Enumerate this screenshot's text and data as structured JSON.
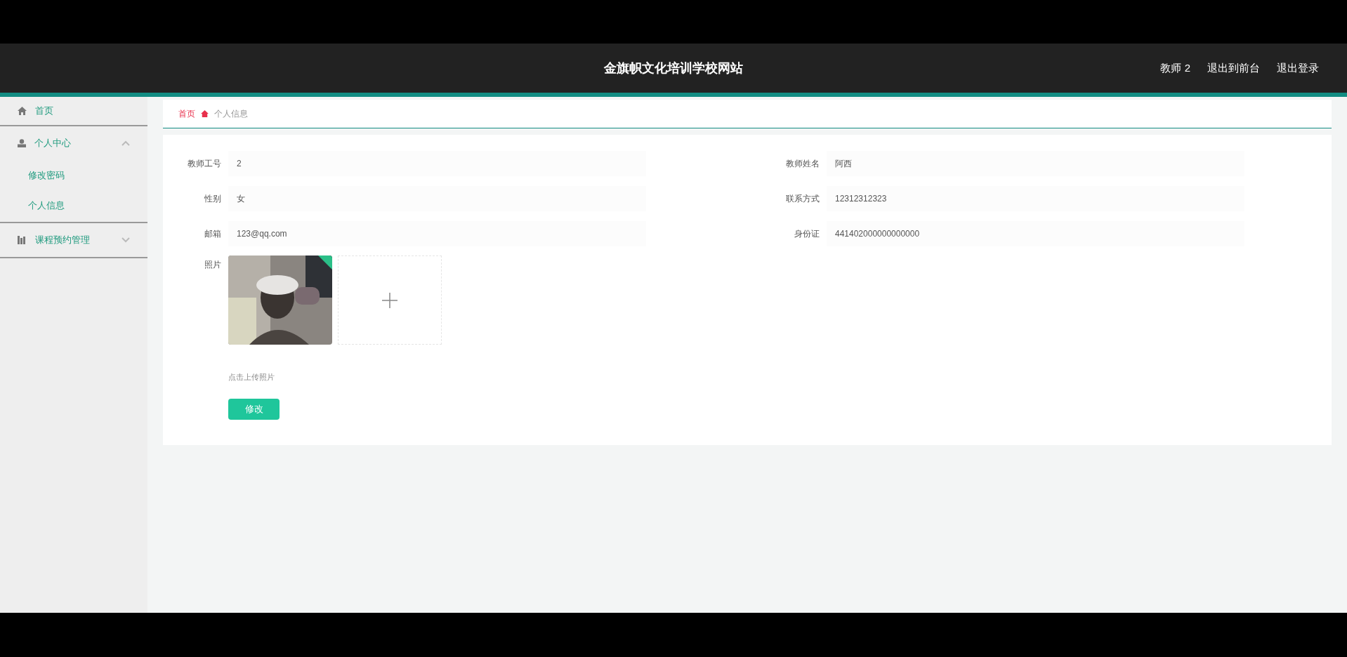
{
  "header": {
    "title": "金旗帜文化培训学校网站",
    "links": [
      "教师 2",
      "退出到前台",
      "退出登录"
    ]
  },
  "sidebar": {
    "items": [
      {
        "label": "首页",
        "kind": "home"
      },
      {
        "label": "个人中心",
        "kind": "user",
        "expanded": true,
        "children": [
          {
            "label": "修改密码"
          },
          {
            "label": "个人信息"
          }
        ]
      },
      {
        "label": "课程预约管理",
        "kind": "chart",
        "expanded": false
      }
    ]
  },
  "breadcrumb": {
    "home": "首页",
    "current": "个人信息"
  },
  "form": {
    "fields": [
      {
        "label": "教师工号",
        "value": "2"
      },
      {
        "label": "教师姓名",
        "value": "阿西"
      },
      {
        "label": "性别",
        "value": "女"
      },
      {
        "label": "联系方式",
        "value": "12312312323"
      },
      {
        "label": "邮箱",
        "value": "123@qq.com"
      },
      {
        "label": "身份证",
        "value": "441402000000000000"
      }
    ],
    "photo": {
      "label": "照片",
      "hint": "点击上传照片"
    },
    "submit": "修改"
  }
}
